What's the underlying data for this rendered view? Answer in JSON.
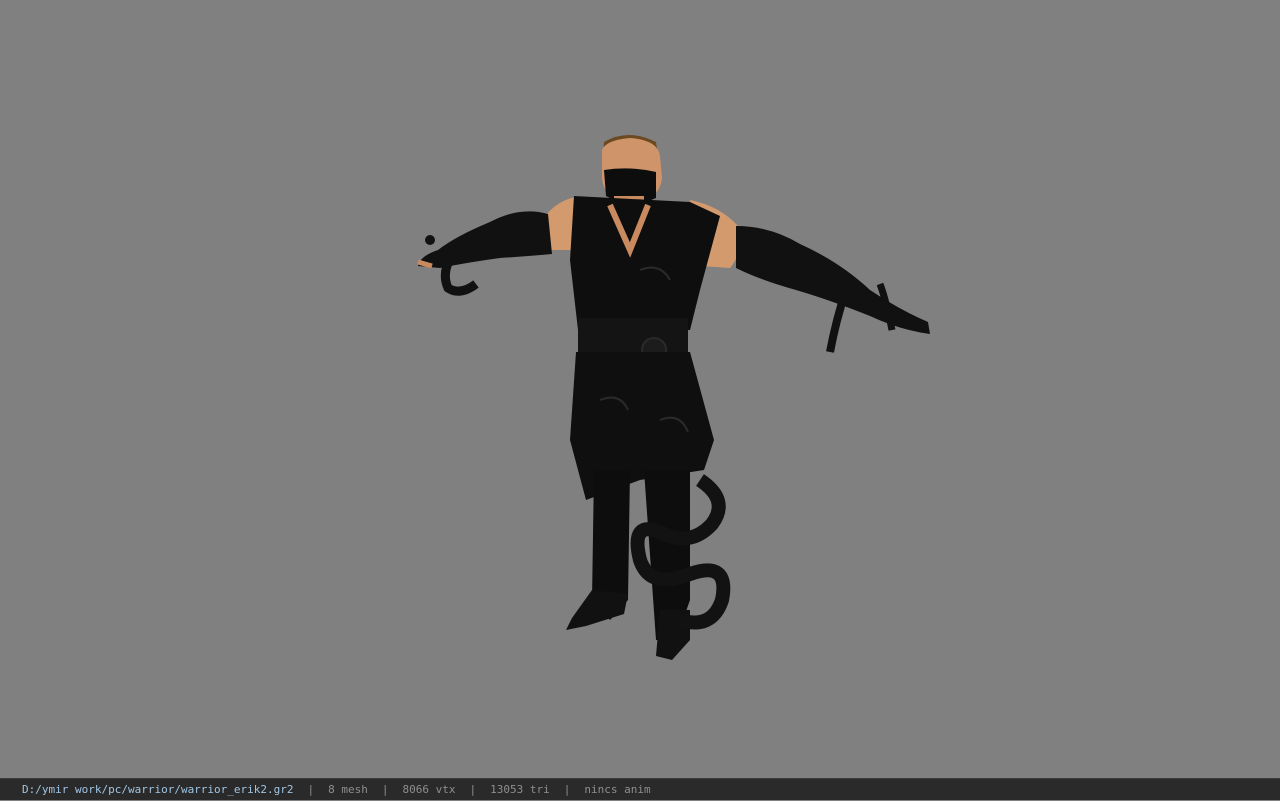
{
  "viewport": {
    "background": "#808080",
    "model_icon": "character-model-icon"
  },
  "statusbar": {
    "file_path": "D:/ymir work/pc/warrior/warrior_erik2.gr2",
    "separator": "|",
    "mesh": "8 mesh",
    "vertices": "8066 vtx",
    "triangles": "13053 tri",
    "animation": "nincs anim",
    "path_color": "#9fc4e2",
    "text_color": "#8e8e8e"
  }
}
